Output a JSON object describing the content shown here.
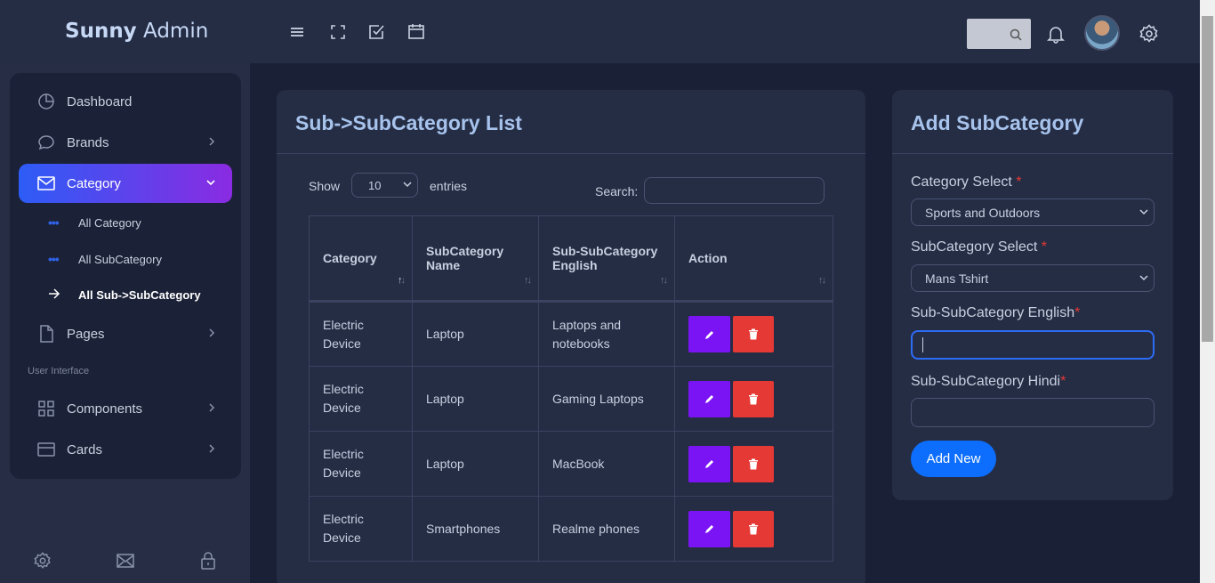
{
  "header": {
    "brand_bold": "Sunny",
    "brand_thin": "Admin"
  },
  "sidebar": {
    "items": [
      {
        "label": "Dashboard",
        "icon": "pie-chart-icon"
      },
      {
        "label": "Brands",
        "icon": "chat-icon"
      },
      {
        "label": "Category",
        "icon": "mail-icon"
      },
      {
        "label": "Pages",
        "icon": "file-icon"
      },
      {
        "label": "Components",
        "icon": "grid-icon"
      },
      {
        "label": "Cards",
        "icon": "card-icon"
      }
    ],
    "sub_items": [
      {
        "label": "All Category"
      },
      {
        "label": "All SubCategory"
      },
      {
        "label": "All Sub->SubCategory"
      }
    ],
    "section_label": "User Interface"
  },
  "list": {
    "title": "Sub->SubCategory List",
    "show_label": "Show",
    "entries_value": "10",
    "entries_label": "entries",
    "search_label": "Search:",
    "columns": [
      "Category",
      "SubCategory Name",
      "Sub-SubCategory English",
      "Action"
    ],
    "rows": [
      {
        "category": "Electric Device",
        "subcategory": "Laptop",
        "subsub": "Laptops and notebooks"
      },
      {
        "category": "Electric Device",
        "subcategory": "Laptop",
        "subsub": "Gaming Laptops"
      },
      {
        "category": "Electric Device",
        "subcategory": "Laptop",
        "subsub": "MacBook"
      },
      {
        "category": "Electric Device",
        "subcategory": "Smartphones",
        "subsub": "Realme phones"
      }
    ]
  },
  "form": {
    "title": "Add SubCategory",
    "category_label": "Category Select ",
    "category_value": "Sports and Outdoors",
    "subcategory_label": "SubCategory Select ",
    "subcategory_value": "Mans Tshirt",
    "english_label": "Sub-SubCategory English",
    "hindi_label": "Sub-SubCategory Hindi",
    "required_mark": "*",
    "submit_label": "Add New"
  },
  "colors": {
    "accent_from": "#2d5cf6",
    "accent_to": "#8a2be2",
    "edit": "#7b14f5",
    "delete": "#e53935",
    "primary": "#0d6efd"
  }
}
